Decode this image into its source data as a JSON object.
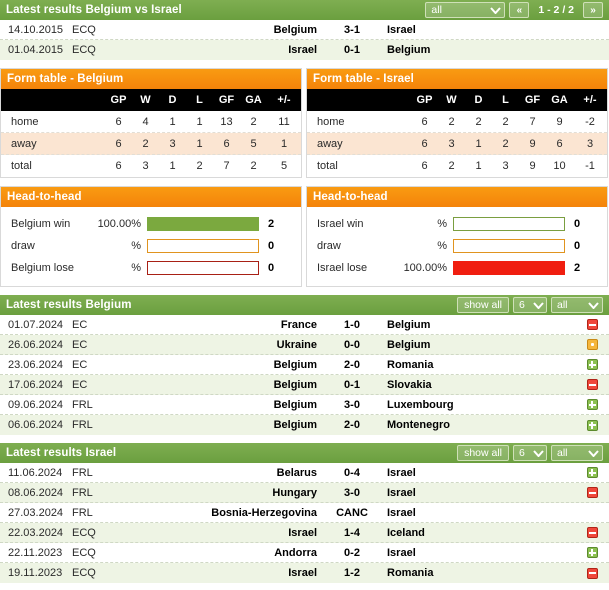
{
  "h2h_results": {
    "title": "Latest results Belgium vs Israel",
    "filter_competition": "all",
    "page_prev_label": "«",
    "page_next_label": "»",
    "page_info": "1 - 2 / 2",
    "rows": [
      {
        "date": "14.10.2015",
        "comp": "ECQ",
        "home": "Belgium",
        "score": "3-1",
        "away": "Israel",
        "status": ""
      },
      {
        "date": "01.04.2015",
        "comp": "ECQ",
        "home": "Israel",
        "score": "0-1",
        "away": "Belgium",
        "status": ""
      }
    ]
  },
  "form_tables": [
    {
      "title": "Form table - Belgium",
      "columns": [
        "GP",
        "W",
        "D",
        "L",
        "GF",
        "GA",
        "+/-"
      ],
      "rows": [
        {
          "label": "home",
          "values": [
            "6",
            "4",
            "1",
            "1",
            "13",
            "2",
            "11"
          ]
        },
        {
          "label": "away",
          "values": [
            "6",
            "2",
            "3",
            "1",
            "6",
            "5",
            "1"
          ]
        },
        {
          "label": "total",
          "values": [
            "6",
            "3",
            "1",
            "2",
            "7",
            "2",
            "5"
          ]
        }
      ]
    },
    {
      "title": "Form table - Israel",
      "columns": [
        "GP",
        "W",
        "D",
        "L",
        "GF",
        "GA",
        "+/-"
      ],
      "rows": [
        {
          "label": "home",
          "values": [
            "6",
            "2",
            "2",
            "2",
            "7",
            "9",
            "-2"
          ]
        },
        {
          "label": "away",
          "values": [
            "6",
            "3",
            "1",
            "2",
            "9",
            "6",
            "3"
          ]
        },
        {
          "label": "total",
          "values": [
            "6",
            "2",
            "1",
            "3",
            "9",
            "10",
            "-1"
          ]
        }
      ]
    }
  ],
  "head_to_head": [
    {
      "title": "Head-to-head",
      "rows": [
        {
          "label": "Belgium win",
          "pct": "100.00%",
          "bar_pct": 100,
          "count": "2",
          "kind": "win"
        },
        {
          "label": "draw",
          "pct": "%",
          "bar_pct": 0,
          "count": "0",
          "kind": "draw"
        },
        {
          "label": "Belgium lose",
          "pct": "%",
          "bar_pct": 0,
          "count": "0",
          "kind": "lose"
        }
      ]
    },
    {
      "title": "Head-to-head",
      "rows": [
        {
          "label": "Israel win",
          "pct": "%",
          "bar_pct": 0,
          "count": "0",
          "kind": "win"
        },
        {
          "label": "draw",
          "pct": "%",
          "bar_pct": 0,
          "count": "0",
          "kind": "draw"
        },
        {
          "label": "Israel lose",
          "pct": "100.00%",
          "bar_pct": 100,
          "count": "2",
          "kind": "lose"
        }
      ]
    }
  ],
  "latest_belgium": {
    "title": "Latest results Belgium",
    "show_all_label": "show all",
    "count_value": "6",
    "competition_value": "all",
    "rows": [
      {
        "date": "01.07.2024",
        "comp": "EC",
        "home": "France",
        "score": "1-0",
        "away": "Belgium",
        "status": "lose"
      },
      {
        "date": "26.06.2024",
        "comp": "EC",
        "home": "Ukraine",
        "score": "0-0",
        "away": "Belgium",
        "status": "draw"
      },
      {
        "date": "23.06.2024",
        "comp": "EC",
        "home": "Belgium",
        "score": "2-0",
        "away": "Romania",
        "status": "win"
      },
      {
        "date": "17.06.2024",
        "comp": "EC",
        "home": "Belgium",
        "score": "0-1",
        "away": "Slovakia",
        "status": "lose"
      },
      {
        "date": "09.06.2024",
        "comp": "FRL",
        "home": "Belgium",
        "score": "3-0",
        "away": "Luxembourg",
        "status": "win"
      },
      {
        "date": "06.06.2024",
        "comp": "FRL",
        "home": "Belgium",
        "score": "2-0",
        "away": "Montenegro",
        "status": "win"
      }
    ]
  },
  "latest_israel": {
    "title": "Latest results Israel",
    "show_all_label": "show all",
    "count_value": "6",
    "competition_value": "all",
    "rows": [
      {
        "date": "11.06.2024",
        "comp": "FRL",
        "home": "Belarus",
        "score": "0-4",
        "away": "Israel",
        "status": "win"
      },
      {
        "date": "08.06.2024",
        "comp": "FRL",
        "home": "Hungary",
        "score": "3-0",
        "away": "Israel",
        "status": "lose"
      },
      {
        "date": "27.03.2024",
        "comp": "FRL",
        "home": "Bosnia-Herzegovina",
        "score": "CANC",
        "away": "Israel",
        "status": ""
      },
      {
        "date": "22.03.2024",
        "comp": "ECQ",
        "home": "Israel",
        "score": "1-4",
        "away": "Iceland",
        "status": "lose"
      },
      {
        "date": "22.11.2023",
        "comp": "ECQ",
        "home": "Andorra",
        "score": "0-2",
        "away": "Israel",
        "status": "win"
      },
      {
        "date": "19.11.2023",
        "comp": "ECQ",
        "home": "Israel",
        "score": "1-2",
        "away": "Romania",
        "status": "lose"
      }
    ]
  },
  "colors": {
    "green": "#6b9f3f",
    "orange": "#f4830a",
    "win": "#8cc152",
    "lose": "#f0483c",
    "draw": "#f5b63c",
    "bar_win_fill": "#7ba93f",
    "bar_lose_fill": "#f01e10"
  }
}
